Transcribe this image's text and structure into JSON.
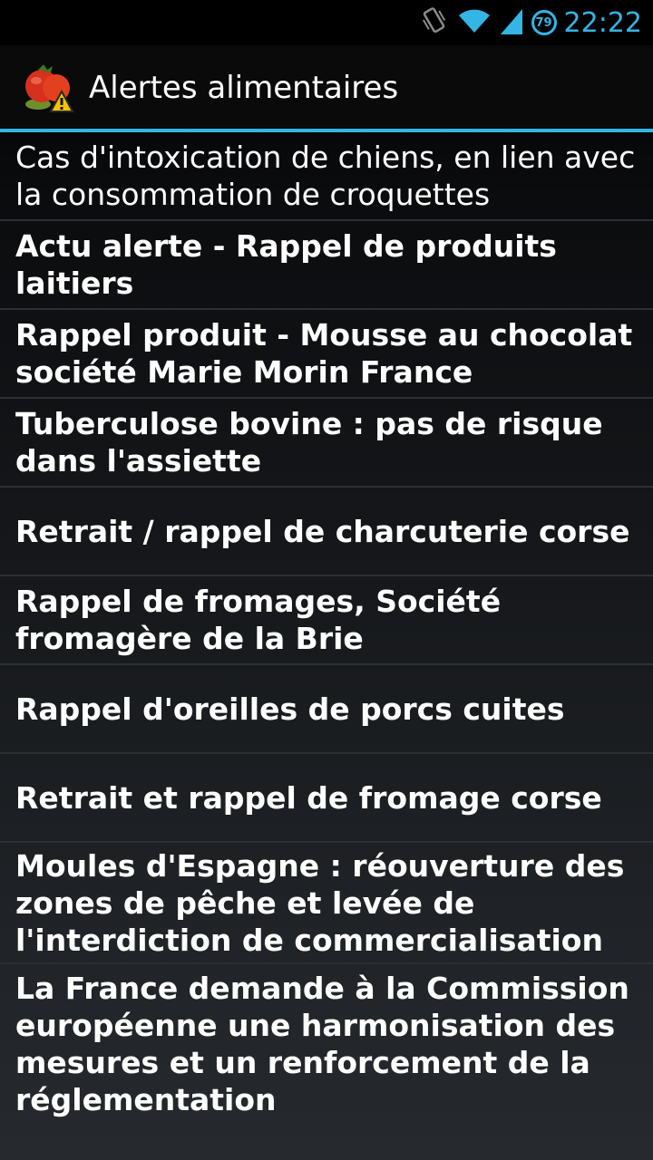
{
  "status_bar": {
    "time": "22:22",
    "battery_level": "79",
    "icons": [
      "vibrate-icon",
      "wifi-icon",
      "signal-icon",
      "battery-icon"
    ]
  },
  "action_bar": {
    "title": "Alertes alimentaires",
    "icon": "tomato-warning-icon",
    "accent_color": "#33b5e5"
  },
  "items": [
    {
      "label": "Cas d'intoxication de chiens, en lien avec la consommation de croquettes",
      "read": true
    },
    {
      "label": "Actu alerte - Rappel de produits laitiers",
      "read": false
    },
    {
      "label": "Rappel produit - Mousse au chocolat société Marie Morin France",
      "read": false
    },
    {
      "label": "Tuberculose bovine : pas de risque dans l'assiette",
      "read": false
    },
    {
      "label": "Retrait / rappel de charcuterie corse",
      "read": false
    },
    {
      "label": "Rappel de fromages, Société fromagère de la Brie",
      "read": false
    },
    {
      "label": "Rappel d'oreilles de porcs cuites",
      "read": false
    },
    {
      "label": "Retrait et rappel de fromage corse",
      "read": false
    },
    {
      "label": "Moules d'Espagne : réouverture des zones de pêche et levée de l'interdiction de commercialisation",
      "read": false
    },
    {
      "label": "La France demande à la Commission européenne une harmonisation des mesures et un renforcement de la réglementation",
      "read": false
    }
  ]
}
